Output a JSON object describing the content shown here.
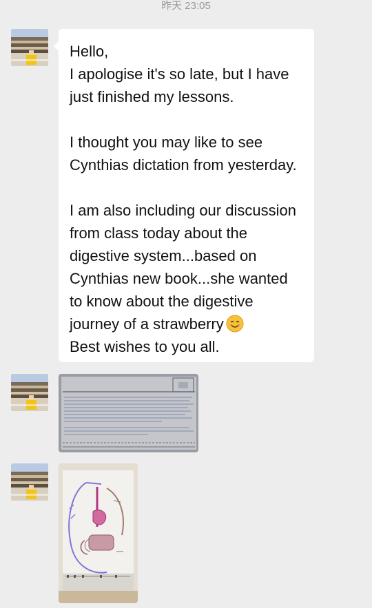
{
  "timestamp": "昨天 23:05",
  "messages": [
    {
      "type": "text",
      "lines": [
        "Hello,",
        "I apologise it's so late, but I have",
        "just finished my lessons.",
        "",
        "I thought you may like to see",
        "Cynthias dictation from yesterday.",
        "",
        "I am also including our discussion",
        "from class today about the",
        "digestive system...based on",
        "Cynthias new book...she wanted",
        "to know about the digestive",
        "journey of a strawberry",
        "Best wishes to you all."
      ],
      "emoji_after_line": 12,
      "emoji_icon": "smiling-face-icon"
    },
    {
      "type": "image",
      "content": "photo of handwritten dictation worksheet"
    },
    {
      "type": "image",
      "content": "photo of digestive system drawing"
    }
  ],
  "colors": {
    "background": "#ededed",
    "bubble": "#ffffff",
    "timestamp": "#9a9a9a",
    "text": "#111111"
  }
}
